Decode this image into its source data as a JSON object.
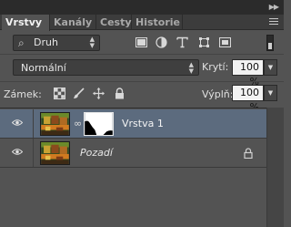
{
  "panel": {
    "tabs": [
      {
        "label": "Vrstvy",
        "active": true
      },
      {
        "label": "Kanály",
        "active": false
      },
      {
        "label": "Cesty",
        "active": false
      },
      {
        "label": "Historie",
        "active": false
      }
    ]
  },
  "filter": {
    "kind_label": "Druh",
    "icons": [
      "pixel-layer-filter-icon",
      "adjustment-layer-filter-icon",
      "type-layer-filter-icon",
      "shape-layer-filter-icon",
      "smart-object-filter-icon"
    ]
  },
  "blend": {
    "mode": "Normální",
    "opacity_label": "Krytí:",
    "opacity_value": "100 %"
  },
  "lock": {
    "label": "Zámek:",
    "icons": [
      "lock-transparent-pixels-icon",
      "lock-image-pixels-icon",
      "lock-position-icon",
      "lock-all-icon"
    ],
    "fill_label": "Výplň:",
    "fill_value": "100 %"
  },
  "layers": [
    {
      "name": "Vrstva 1",
      "selected": true,
      "has_mask": true,
      "locked": false,
      "visible": true
    },
    {
      "name": "Pozadí",
      "selected": false,
      "has_mask": false,
      "locked": true,
      "visible": true
    }
  ],
  "colors": {
    "panel_bg": "#535353",
    "selected_row": "#5c6b7e",
    "field_bg": "#3f3f3f"
  }
}
